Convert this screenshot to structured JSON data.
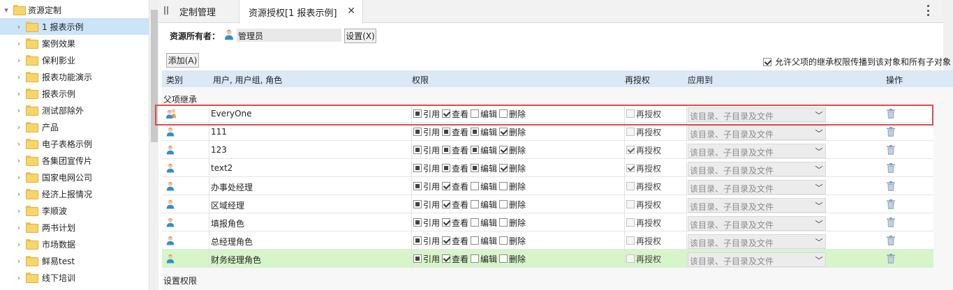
{
  "tree": {
    "root_label": "资源定制",
    "items": [
      {
        "label": "1 报表示例",
        "selected": true
      },
      {
        "label": "案例效果"
      },
      {
        "label": "保利影业"
      },
      {
        "label": "报表功能演示"
      },
      {
        "label": "报表示例"
      },
      {
        "label": "测试部除外"
      },
      {
        "label": "产品"
      },
      {
        "label": "电子表格示例"
      },
      {
        "label": "各集团宣传片"
      },
      {
        "label": "国家电网公司"
      },
      {
        "label": "经济上报情况"
      },
      {
        "label": "李顺波"
      },
      {
        "label": "两书计划"
      },
      {
        "label": "市场数据"
      },
      {
        "label": "鲜易test"
      },
      {
        "label": "线下培训"
      }
    ]
  },
  "tabs": [
    {
      "label": "定制管理"
    },
    {
      "label": "资源授权[1 报表示例]",
      "active": true
    }
  ],
  "owner": {
    "label": "资源所有者：",
    "value": "管理员",
    "set_button": "设置(X)"
  },
  "add_button": "添加(A)",
  "propagate": {
    "label": "允许父项的继承权限传播到该对象和所有子对象",
    "checked": true
  },
  "table": {
    "headers": {
      "type": "类别",
      "users": "用户, 用户组, 角色",
      "perms": "权限",
      "regrant": "再授权",
      "apply": "应用到",
      "ops": "操作"
    },
    "section_inherit": "父项继承",
    "section_set": "设置权限",
    "perm_labels": {
      "ref": "引用",
      "view": "查看",
      "edit": "编辑",
      "delete": "删除"
    },
    "regrant_label": "再授权",
    "apply_placeholder": "该目录、子目录及文件",
    "rows": [
      {
        "name": "EveryOne",
        "icon": "group-users-icon",
        "ref": "partial",
        "view": "checked",
        "edit": "empty",
        "delete": "empty",
        "regrant": "empty",
        "framed": true
      },
      {
        "name": "111",
        "icon": "user-icon",
        "ref": "partial",
        "view": "partial",
        "edit": "partial",
        "delete": "checked",
        "regrant": "empty"
      },
      {
        "name": "123",
        "icon": "user-icon",
        "ref": "partial",
        "view": "partial",
        "edit": "partial",
        "delete": "checked",
        "regrant": "checked"
      },
      {
        "name": "text2",
        "icon": "user-icon",
        "ref": "partial",
        "view": "partial",
        "edit": "partial",
        "delete": "checked",
        "regrant": "checked"
      },
      {
        "name": "办事处经理",
        "icon": "user-icon",
        "ref": "partial",
        "view": "checked",
        "edit": "empty",
        "delete": "empty",
        "regrant": "empty"
      },
      {
        "name": "区域经理",
        "icon": "user-icon",
        "ref": "partial",
        "view": "checked",
        "edit": "empty",
        "delete": "empty",
        "regrant": "empty"
      },
      {
        "name": "填报角色",
        "icon": "user-icon",
        "ref": "partial",
        "view": "checked",
        "edit": "empty",
        "delete": "empty",
        "regrant": "empty"
      },
      {
        "name": "总经理角色",
        "icon": "user-icon",
        "ref": "partial",
        "view": "checked",
        "edit": "empty",
        "delete": "empty",
        "regrant": "empty"
      },
      {
        "name": "财务经理角色",
        "icon": "user-icon",
        "ref": "partial",
        "view": "checked",
        "edit": "empty",
        "delete": "empty",
        "regrant": "empty",
        "highlighted": true
      }
    ]
  }
}
